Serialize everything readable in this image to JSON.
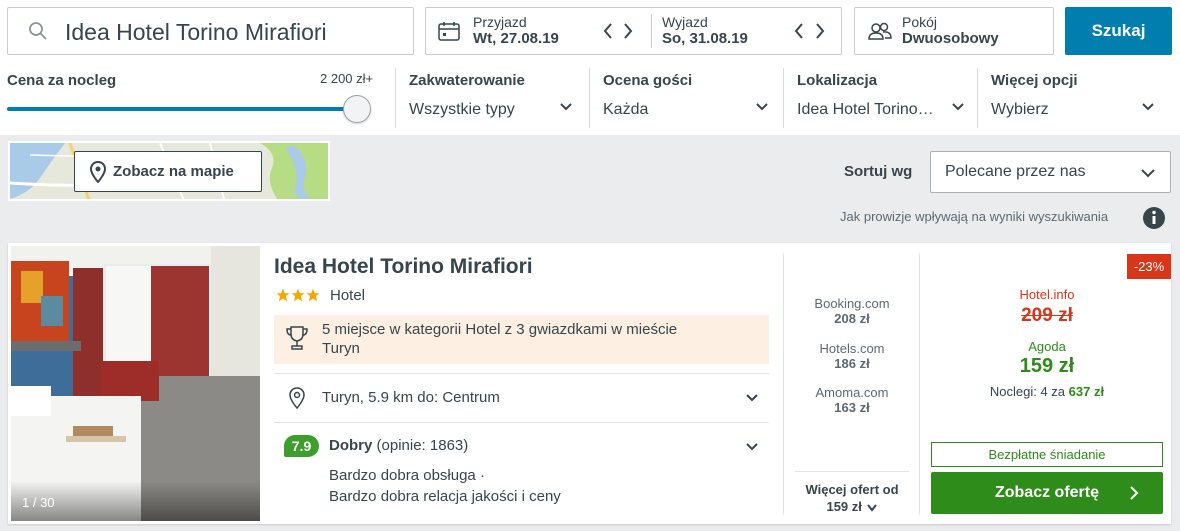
{
  "search": {
    "query": "Idea Hotel Torino Mirafiori",
    "checkin_label": "Przyjazd",
    "checkin_value": "Wt, 27.08.19",
    "checkout_label": "Wyjazd",
    "checkout_value": "So, 31.08.19",
    "room_label": "Pokój",
    "room_value": "Dwuosobowy",
    "submit_label": "Szukaj"
  },
  "filters": {
    "price": {
      "title": "Cena za nocleg",
      "max_label": "2 200 zł+",
      "slider_fraction": 1.0
    },
    "items": [
      {
        "title": "Zakwaterowanie",
        "value": "Wszystkie typy"
      },
      {
        "title": "Ocena gości",
        "value": "Każda"
      },
      {
        "title": "Lokalizacja",
        "value": "Idea Hotel Torino…"
      },
      {
        "title": "Więcej opcji",
        "value": "Wybierz"
      }
    ]
  },
  "map": {
    "button_label": "Zobacz na mapie"
  },
  "sort": {
    "label": "Sortuj wg",
    "value": "Polecane przez nas"
  },
  "commission_note": "Jak prowizje wpływają na wyniki wyszukiwania",
  "result": {
    "photo_counter": "1 / 30",
    "name": "Idea Hotel Torino Mirafiori",
    "stars": 3,
    "type": "Hotel",
    "ranking_line1": "5 miejsce w kategorii Hotel z 3 gwiazdkami w mieście",
    "ranking_line2": "Turyn",
    "location": "Turyn, 5.9 km do: Centrum",
    "rating_score": "7.9",
    "rating_word": "Dobry",
    "rating_count": "(opinie: 1863)",
    "highlights": [
      "Bardzo dobra obsługa ·",
      "Bardzo dobra relacja jakości i ceny"
    ],
    "ota": [
      {
        "name": "Booking.com",
        "price": "208 zł"
      },
      {
        "name": "Hotels.com",
        "price": "186 zł"
      },
      {
        "name": "Amoma.com",
        "price": "163 zł"
      }
    ],
    "more_offers_label": "Więcej ofert od",
    "more_offers_price": "159 zł",
    "discount": "-23%",
    "strike_provider": "Hotel.info",
    "strike_price": "209 zł",
    "best_provider": "Agoda",
    "best_price": "159 zł",
    "nights_prefix": "Noclegi: 4 za",
    "nights_total": "637 zł",
    "breakfast": "Bezpłatne śniadanie",
    "cta_label": "Zobacz ofertę"
  },
  "colors": {
    "brand_blue": "#007faf",
    "deal_green": "#2d8c1a",
    "discount_red": "#d7361a",
    "star_yellow": "#f7a600"
  }
}
